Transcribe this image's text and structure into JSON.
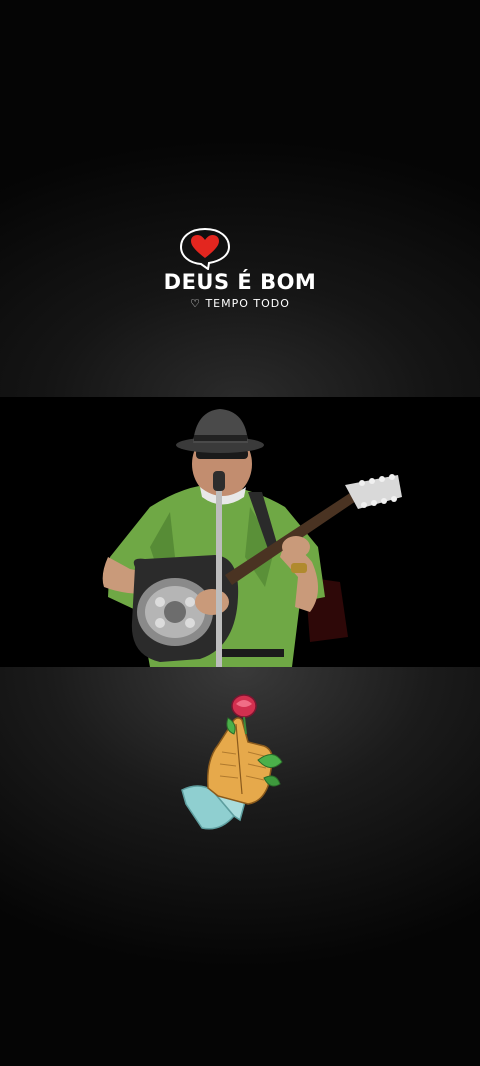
{
  "top_overlay": {
    "logo_title": "DEUS É BOM",
    "logo_subtitle": "♡ TEMPO TODO",
    "icon": "heart-speech-bubble-icon"
  },
  "video": {
    "subject": "musician-playing-resonator-guitar",
    "background_color": "#000000"
  },
  "bottom_overlay": {
    "sticker": "praying-hands-rose-sticker"
  },
  "colors": {
    "heart_red": "#e3261f",
    "text_white": "#ffffff",
    "shirt_green": "#6fa845"
  }
}
